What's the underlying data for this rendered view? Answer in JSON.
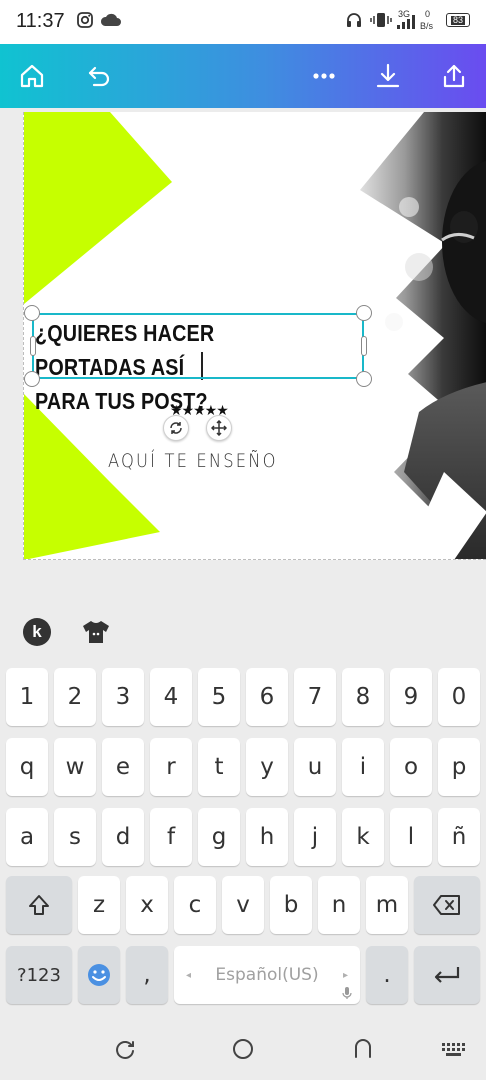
{
  "status_bar": {
    "time": "11:37",
    "network_type": "3G",
    "speed_value": "0",
    "speed_unit": "B/s",
    "battery": "83"
  },
  "toolbar": {
    "home_icon": "home-icon",
    "undo_icon": "undo-icon",
    "more_icon": "more-horizontal-icon",
    "download_icon": "download-icon",
    "share_icon": "share-icon"
  },
  "design": {
    "headline_line1": "¿QUIERES HACER PORTADAS ASÍ",
    "headline_line2": "PARA TUS POST?",
    "stars": "★★★★★",
    "subtitle": "AQUÍ TE ENSEÑO",
    "accent_color": "#c6ff00",
    "selection_color": "#19b8c9"
  },
  "keyboard": {
    "toolbar_icons": [
      "k-logo-icon",
      "tshirt-icon"
    ],
    "row_numbers": [
      "1",
      "2",
      "3",
      "4",
      "5",
      "6",
      "7",
      "8",
      "9",
      "0"
    ],
    "row1": [
      "q",
      "w",
      "e",
      "r",
      "t",
      "y",
      "u",
      "i",
      "o",
      "p"
    ],
    "row2": [
      "a",
      "s",
      "d",
      "f",
      "g",
      "h",
      "j",
      "k",
      "l",
      "ñ"
    ],
    "row3": [
      "z",
      "x",
      "c",
      "v",
      "b",
      "n",
      "m"
    ],
    "symbols_key": "?123",
    "comma_key": ",",
    "space_label": "Español(US)",
    "period_key": "."
  },
  "nav_bar": {
    "icons": [
      "recent-apps-icon",
      "home-circle-icon",
      "back-icon",
      "keyboard-icon"
    ]
  }
}
